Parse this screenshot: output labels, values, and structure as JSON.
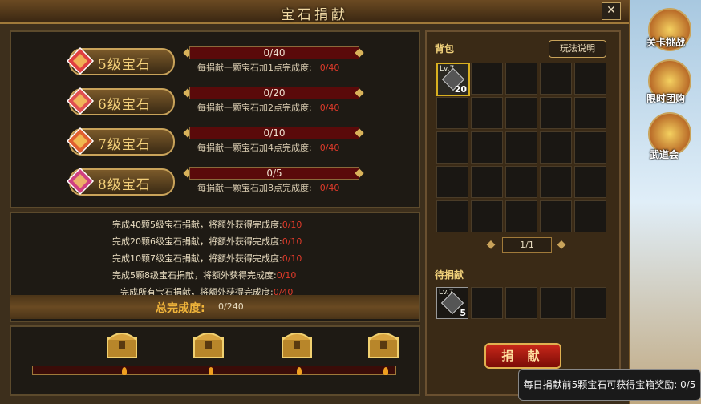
{
  "window": {
    "title": "宝石捐献",
    "close_label": "✕"
  },
  "gems": [
    {
      "name": "5级宝石",
      "progress": "0/40",
      "hint": "每捐献一颗宝石加1点完成度:",
      "hint_value": "0/40",
      "fill": 0,
      "color": "#e04040"
    },
    {
      "name": "6级宝石",
      "progress": "0/20",
      "hint": "每捐献一颗宝石加2点完成度:",
      "hint_value": "0/40",
      "fill": 0,
      "color": "#e05050"
    },
    {
      "name": "7级宝石",
      "progress": "0/10",
      "hint": "每捐献一颗宝石加4点完成度:",
      "hint_value": "0/40",
      "fill": 0,
      "color": "#e06030"
    },
    {
      "name": "8级宝石",
      "progress": "0/5",
      "hint": "每捐献一颗宝石加8点完成度:",
      "hint_value": "0/40",
      "fill": 0,
      "color": "#d04080"
    }
  ],
  "bonuses": [
    {
      "text": "完成40颗5级宝石捐献，将额外获得完成度:",
      "value": "0/10"
    },
    {
      "text": "完成20颗6级宝石捐献，将额外获得完成度:",
      "value": "0/10"
    },
    {
      "text": "完成10颗7级宝石捐献，将额外获得完成度:",
      "value": "0/10"
    },
    {
      "text": "完成5颗8级宝石捐献，将额外获得完成度:",
      "value": "0/10"
    },
    {
      "text": "完成所有宝石捐献，将额外获得完成度:",
      "value": "0/40"
    }
  ],
  "total": {
    "label": "总完成度:",
    "value": "0/240"
  },
  "chests": {
    "count": 4,
    "progress_fraction": 0
  },
  "bag": {
    "title": "背包",
    "help_label": "玩法说明",
    "item": {
      "level": "Lv.7",
      "count": "20"
    },
    "pager": {
      "prev": "◆",
      "text": "1/1",
      "next": "◆"
    }
  },
  "pending": {
    "title": "待捐献",
    "item": {
      "level": "Lv.7",
      "count": "5"
    }
  },
  "donate_label": "捐 献",
  "side_menu": [
    {
      "label": "关卡挑战",
      "icon": "shield-icon"
    },
    {
      "label": "限时团购",
      "icon": "character-icon"
    },
    {
      "label": "武道会",
      "icon": "dragon-icon"
    }
  ],
  "tooltip": "每日捐献前5颗宝石可获得宝箱奖励: 0/5",
  "colors": {
    "accent": "#c9a35a",
    "red": "#e03a2a",
    "bar": "#5a0a0a"
  }
}
